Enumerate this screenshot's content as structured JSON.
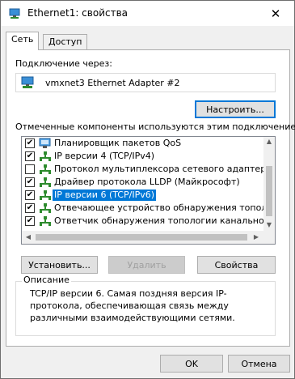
{
  "window": {
    "title": "Ethernet1: свойства",
    "close_glyph": "✕"
  },
  "tabs": [
    {
      "label": "Сеть",
      "active": true
    },
    {
      "label": "Доступ",
      "active": false
    }
  ],
  "connect_using_label": "Подключение через:",
  "adapter_name": "vmxnet3 Ethernet Adapter #2",
  "configure_button": "Настроить...",
  "components_label": "Отмеченные компоненты используются этим подключением:",
  "components": [
    {
      "label": "Планировщик пакетов QoS",
      "checked": true,
      "icon": "qos-icon",
      "selected": false
    },
    {
      "label": "IP версии 4 (TCP/IPv4)",
      "checked": true,
      "icon": "protocol-icon",
      "selected": false
    },
    {
      "label": "Протокол мультиплексора сетевого адаптера (Май",
      "checked": false,
      "icon": "protocol-icon",
      "selected": false
    },
    {
      "label": "Драйвер протокола LLDP (Майкрософт)",
      "checked": true,
      "icon": "protocol-icon",
      "selected": false
    },
    {
      "label": "IP версии 6 (TCP/IPv6)",
      "checked": true,
      "icon": "protocol-icon",
      "selected": true
    },
    {
      "label": "Отвечающее устройство обнаружения топологии к",
      "checked": true,
      "icon": "protocol-icon",
      "selected": false
    },
    {
      "label": "Ответчик обнаружения топологии канального урове",
      "checked": true,
      "icon": "protocol-icon",
      "selected": false
    }
  ],
  "check_glyph": "✔",
  "scroll_arrows": {
    "up": "▲",
    "down": "▼",
    "left": "◀",
    "right": "▶"
  },
  "buttons": {
    "install": "Установить...",
    "uninstall": "Удалить",
    "properties": "Свойства",
    "ok": "OK",
    "cancel": "Отмена"
  },
  "description": {
    "title": "Описание",
    "text": "TCP/IP версии 6. Самая поздняя версия IP-протокола, обеспечивающая связь между различными взаимодействующими сетями."
  },
  "colors": {
    "accent": "#0078d7",
    "window_bg": "#f0f0f0",
    "protocol_green": "#2e8b2e"
  }
}
